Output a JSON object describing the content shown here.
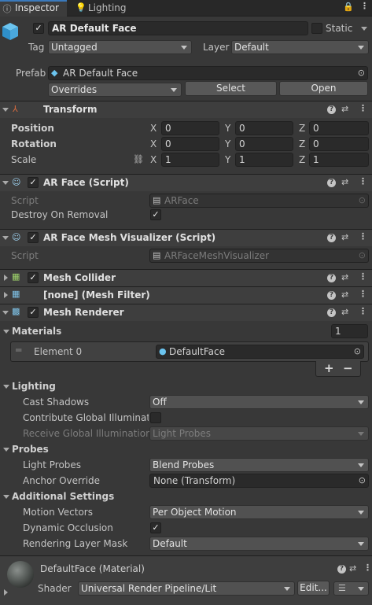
{
  "tabs": [
    {
      "label": "Inspector"
    },
    {
      "label": "Lighting"
    }
  ],
  "header": {
    "object_name": "AR Default Face",
    "static_label": "Static",
    "tag_label": "Tag",
    "tag_value": "Untagged",
    "layer_label": "Layer",
    "layer_value": "Default",
    "prefab_label": "Prefab",
    "prefab_value": "AR Default Face",
    "overrides_value": "Overrides",
    "select_label": "Select",
    "open_label": "Open"
  },
  "transform": {
    "title": "Transform",
    "position_label": "Position",
    "rotation_label": "Rotation",
    "scale_label": "Scale",
    "position": {
      "x": "0",
      "y": "0",
      "z": "0"
    },
    "rotation": {
      "x": "0",
      "y": "0",
      "z": "0"
    },
    "scale": {
      "x": "1",
      "y": "1",
      "z": "1"
    },
    "axis": {
      "x": "X",
      "y": "Y",
      "z": "Z"
    }
  },
  "ar_face": {
    "title": "AR Face (Script)",
    "script_label": "Script",
    "script_value": "ARFace",
    "destroy_label": "Destroy On Removal"
  },
  "ar_face_mesh": {
    "title": "AR Face Mesh Visualizer (Script)",
    "script_label": "Script",
    "script_value": "ARFaceMeshVisualizer"
  },
  "mesh_collider": {
    "title": "Mesh Collider"
  },
  "mesh_filter": {
    "title": "[none] (Mesh Filter)"
  },
  "mesh_renderer": {
    "title": "Mesh Renderer",
    "materials_label": "Materials",
    "materials_count": "1",
    "element_label": "Element 0",
    "element_value": "DefaultFace",
    "plus": "+",
    "minus": "−",
    "lighting": {
      "title": "Lighting",
      "cast_shadows_label": "Cast Shadows",
      "cast_shadows_value": "Off",
      "contribute_gi_label": "Contribute Global Illuminatio",
      "receive_gi_label": "Receive Global Illumination",
      "receive_gi_value": "Light Probes"
    },
    "probes": {
      "title": "Probes",
      "light_probes_label": "Light Probes",
      "light_probes_value": "Blend Probes",
      "anchor_label": "Anchor Override",
      "anchor_value": "None (Transform)"
    },
    "additional": {
      "title": "Additional Settings",
      "motion_label": "Motion Vectors",
      "motion_value": "Per Object Motion",
      "occlusion_label": "Dynamic Occlusion",
      "layer_mask_label": "Rendering Layer Mask",
      "layer_mask_value": "Default"
    }
  },
  "material": {
    "name": "DefaultFace (Material)",
    "shader_label": "Shader",
    "shader_value": "Universal Render Pipeline/Lit",
    "edit_label": "Edit..."
  }
}
